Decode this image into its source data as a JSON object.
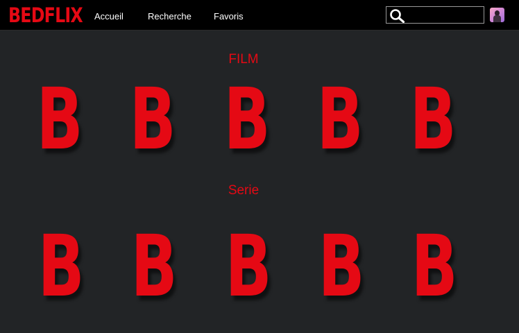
{
  "header": {
    "logo_text": "BEDFLIX",
    "nav": [
      {
        "label": "Accueil"
      },
      {
        "label": "Recherche"
      },
      {
        "label": "Favoris"
      }
    ],
    "search": {
      "value": "",
      "icon": "search-icon"
    },
    "avatar": {
      "icon": "user-avatar"
    }
  },
  "sections": [
    {
      "title": "FILM",
      "posters": [
        {
          "glyph": "B"
        },
        {
          "glyph": "B"
        },
        {
          "glyph": "B"
        },
        {
          "glyph": "B"
        },
        {
          "glyph": "B"
        }
      ]
    },
    {
      "title": "Serie",
      "posters": [
        {
          "glyph": "B"
        },
        {
          "glyph": "B"
        },
        {
          "glyph": "B"
        },
        {
          "glyph": "B"
        },
        {
          "glyph": "B"
        }
      ]
    }
  ],
  "colors": {
    "brand": "#e50914",
    "background": "#222426",
    "topbar": "#000000"
  }
}
